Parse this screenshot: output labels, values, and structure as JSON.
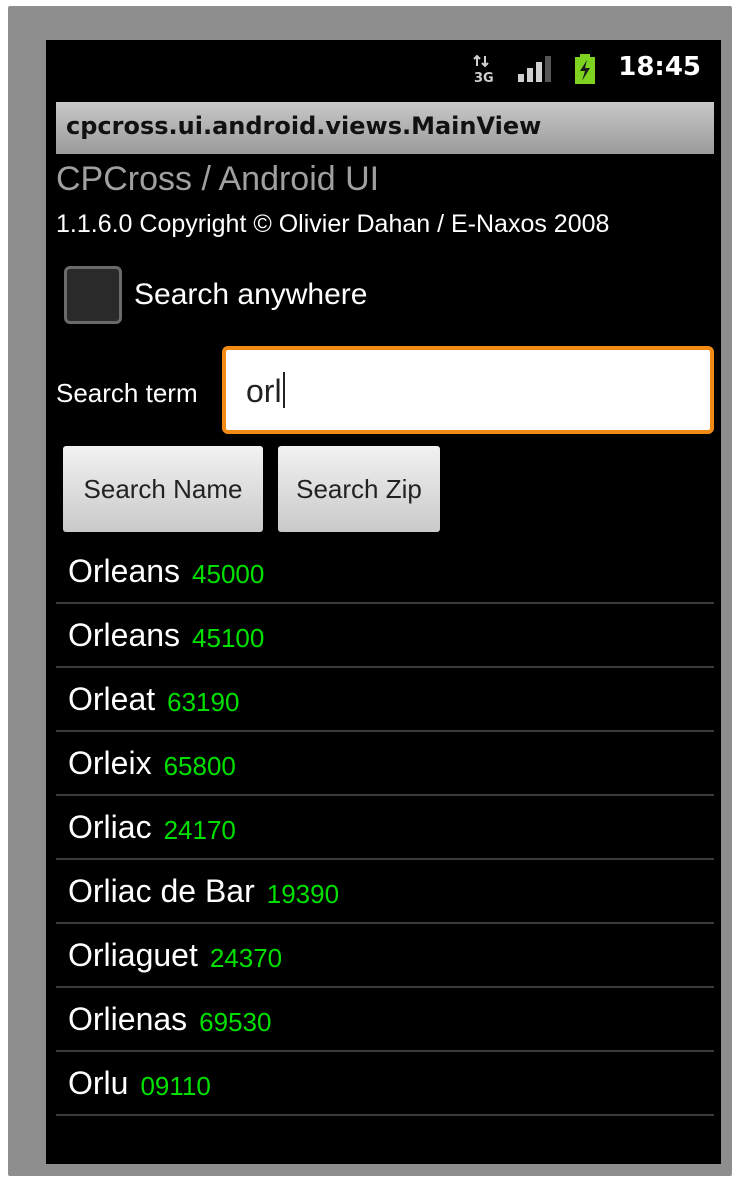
{
  "status_bar": {
    "time": "18:45",
    "network_icon": "3g-data-icon",
    "signal_icon": "signal-bars-icon",
    "battery_icon": "battery-charging-icon"
  },
  "window": {
    "title": "cpcross.ui.android.views.MainView"
  },
  "app": {
    "title": "CPCross / Android UI",
    "copyright": "1.1.6.0 Copyright © Olivier Dahan / E-Naxos 2008"
  },
  "options": {
    "search_anywhere_label": "Search anywhere",
    "search_anywhere_checked": false
  },
  "search": {
    "label": "Search term",
    "value": "orl"
  },
  "buttons": {
    "search_name": "Search Name",
    "search_zip": "Search Zip"
  },
  "results": [
    {
      "city": "Orleans",
      "zip": "45000"
    },
    {
      "city": "Orleans",
      "zip": "45100"
    },
    {
      "city": "Orleat",
      "zip": "63190"
    },
    {
      "city": "Orleix",
      "zip": "65800"
    },
    {
      "city": "Orliac",
      "zip": "24170"
    },
    {
      "city": "Orliac de Bar",
      "zip": "19390"
    },
    {
      "city": "Orliaguet",
      "zip": "24370"
    },
    {
      "city": "Orlienas",
      "zip": "69530"
    },
    {
      "city": "Orlu",
      "zip": "09110"
    }
  ],
  "colors": {
    "focus_border": "#f28a13",
    "zip_text": "#00e000",
    "battery_charge": "#7ed321"
  }
}
